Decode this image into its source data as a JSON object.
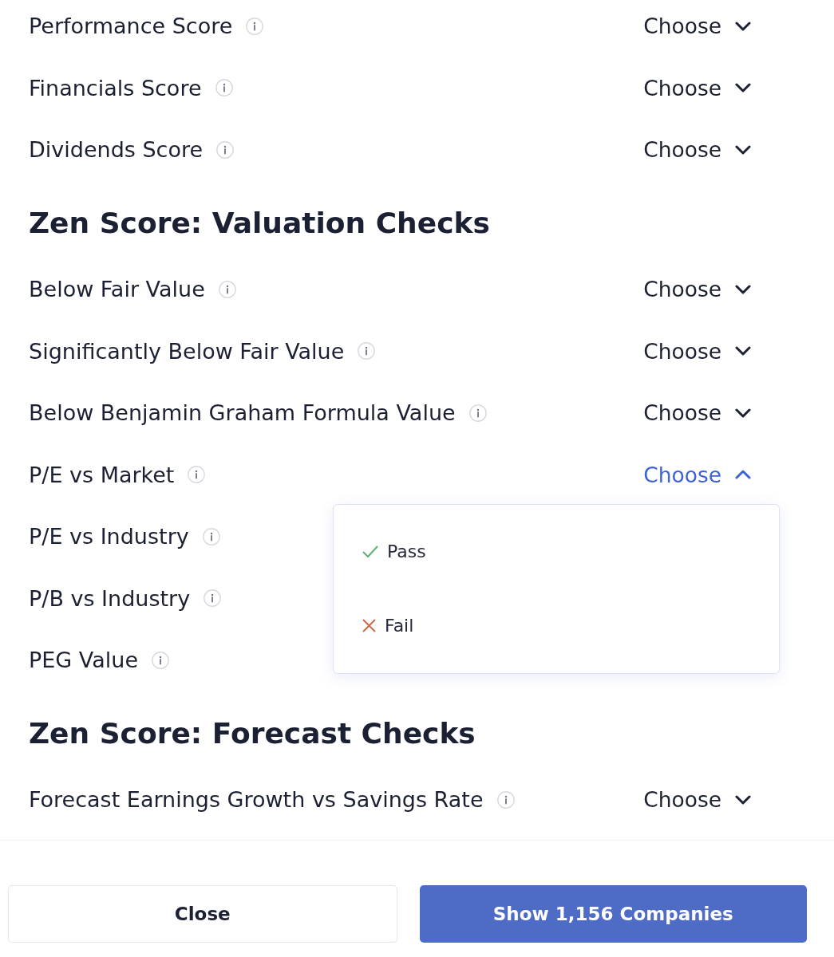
{
  "sections": [
    {
      "filters": [
        {
          "label": "Performance Score",
          "value": "Choose",
          "expanded": false
        },
        {
          "label": "Financials Score",
          "value": "Choose",
          "expanded": false
        },
        {
          "label": "Dividends Score",
          "value": "Choose",
          "expanded": false
        }
      ]
    },
    {
      "title": "Zen Score: Valuation Checks",
      "filters": [
        {
          "label": "Below Fair Value",
          "value": "Choose",
          "expanded": false
        },
        {
          "label": "Significantly Below Fair Value",
          "value": "Choose",
          "expanded": false
        },
        {
          "label": "Below Benjamin Graham Formula Value",
          "value": "Choose",
          "expanded": false
        },
        {
          "label": "P/E vs Market",
          "value": "Choose",
          "expanded": true,
          "options": [
            {
              "label": "Pass",
              "kind": "pass"
            },
            {
              "label": "Fail",
              "kind": "fail"
            }
          ]
        },
        {
          "label": "P/E vs Industry"
        },
        {
          "label": "P/B vs Industry"
        },
        {
          "label": "PEG Value"
        }
      ]
    },
    {
      "title": "Zen Score: Forecast Checks",
      "filters": [
        {
          "label": "Forecast Earnings Growth vs Savings Rate",
          "value": "Choose",
          "expanded": false
        }
      ]
    }
  ],
  "footer": {
    "buttons": [
      {
        "label": "Close",
        "kind": "secondary"
      },
      {
        "label": "Show 1,156 Companies",
        "kind": "primary"
      }
    ]
  }
}
